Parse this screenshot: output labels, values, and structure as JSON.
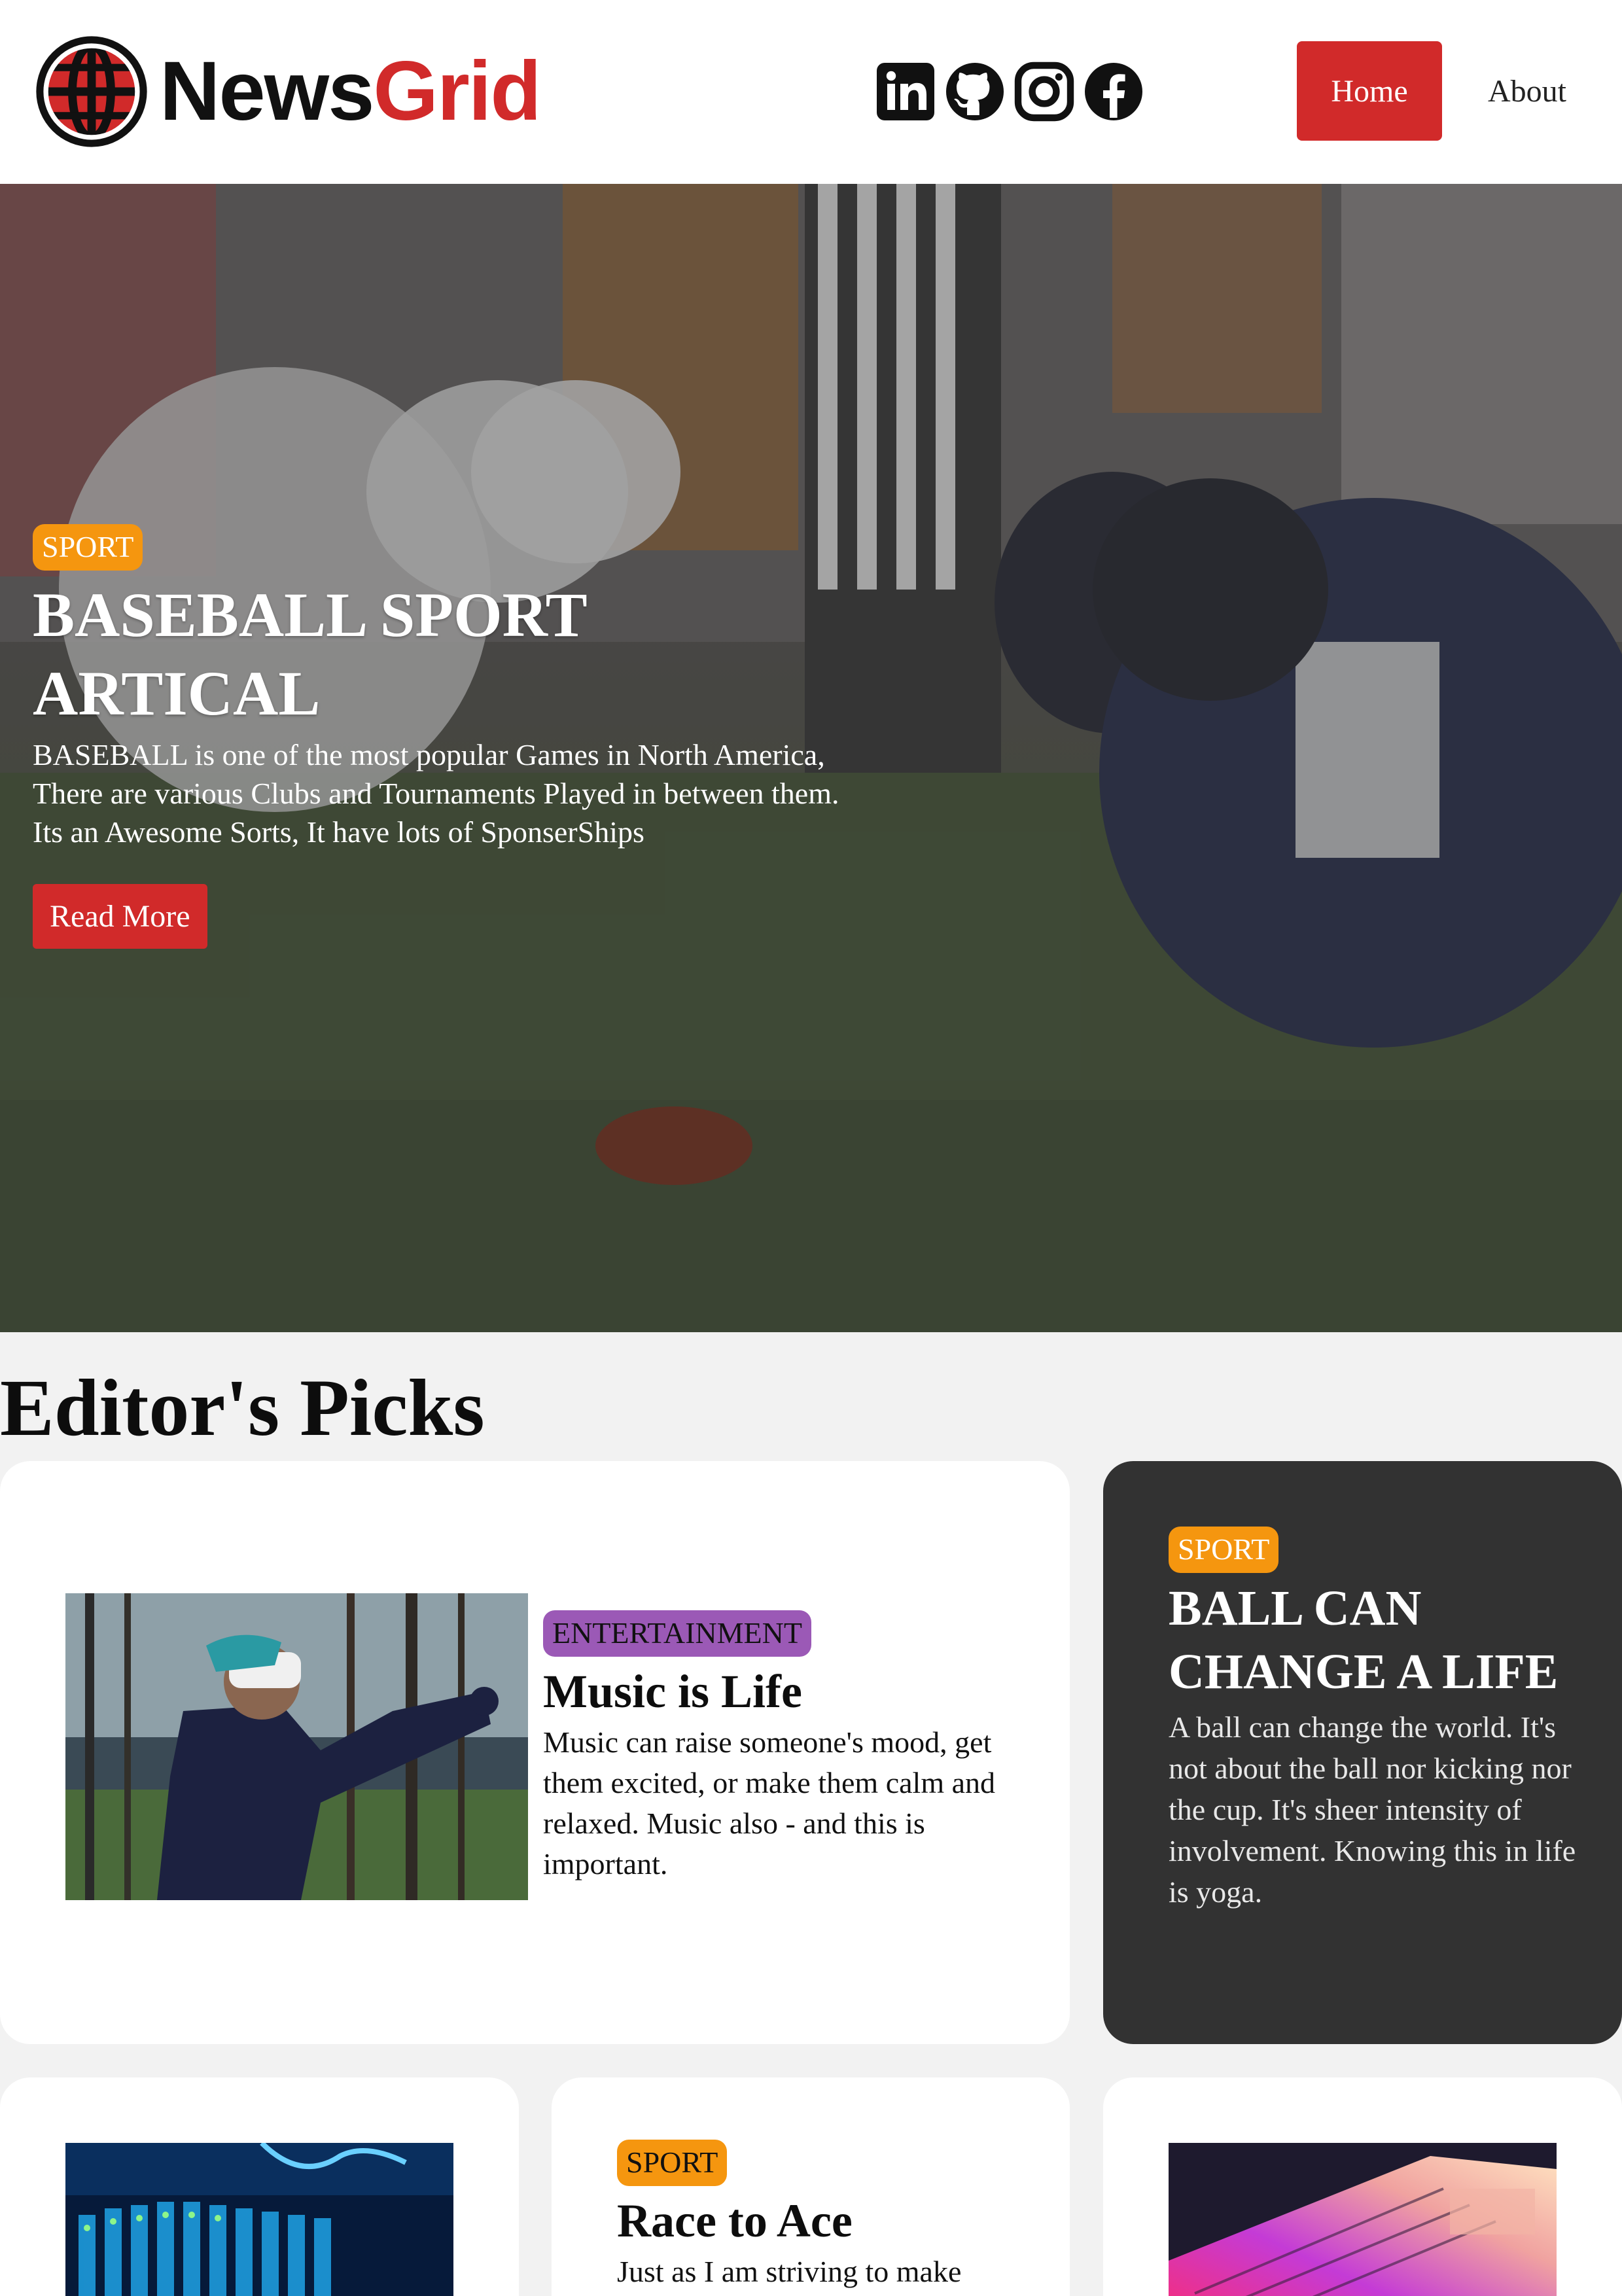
{
  "header": {
    "logo": {
      "part1": "News",
      "part2": "Grid"
    },
    "socials": [
      "linkedin-icon",
      "github-icon",
      "instagram-icon",
      "facebook-icon"
    ],
    "nav": {
      "home": "Home",
      "about": "About"
    }
  },
  "hero": {
    "category": "SPORT",
    "title": "BASEBALL SPORT ARTICAL",
    "description": "BASEBALL is one of the most popular Games in North America, There are various Clubs and Tournaments Played in between them. Its an Awesome Sorts, It have lots of SponserShips",
    "button": "Read More"
  },
  "editors_picks": {
    "title": "Editor's Picks",
    "cards": [
      {
        "category": "ENTERTAINMENT",
        "title": "Music is Life",
        "description": "Music can raise someone's mood, get them excited, or make them calm and relaxed. Music also - and this is important."
      },
      {
        "category": "SPORT",
        "title": "BALL CAN CHANGE A LIFE",
        "description": "A ball can change the world. It's not about the ball nor kicking nor the cup. It's sheer intensity of involvement. Knowing this in life is yoga."
      },
      {
        "category": "SPORT",
        "title": "Race to Ace",
        "description": "Just as I am striving to make"
      }
    ]
  },
  "colors": {
    "brand_red": "#d12a2a",
    "sport_badge": "#f5960f",
    "entertainment_badge": "#9b59b6",
    "dark_card": "#323232",
    "page_bg": "#f2f2f2"
  }
}
